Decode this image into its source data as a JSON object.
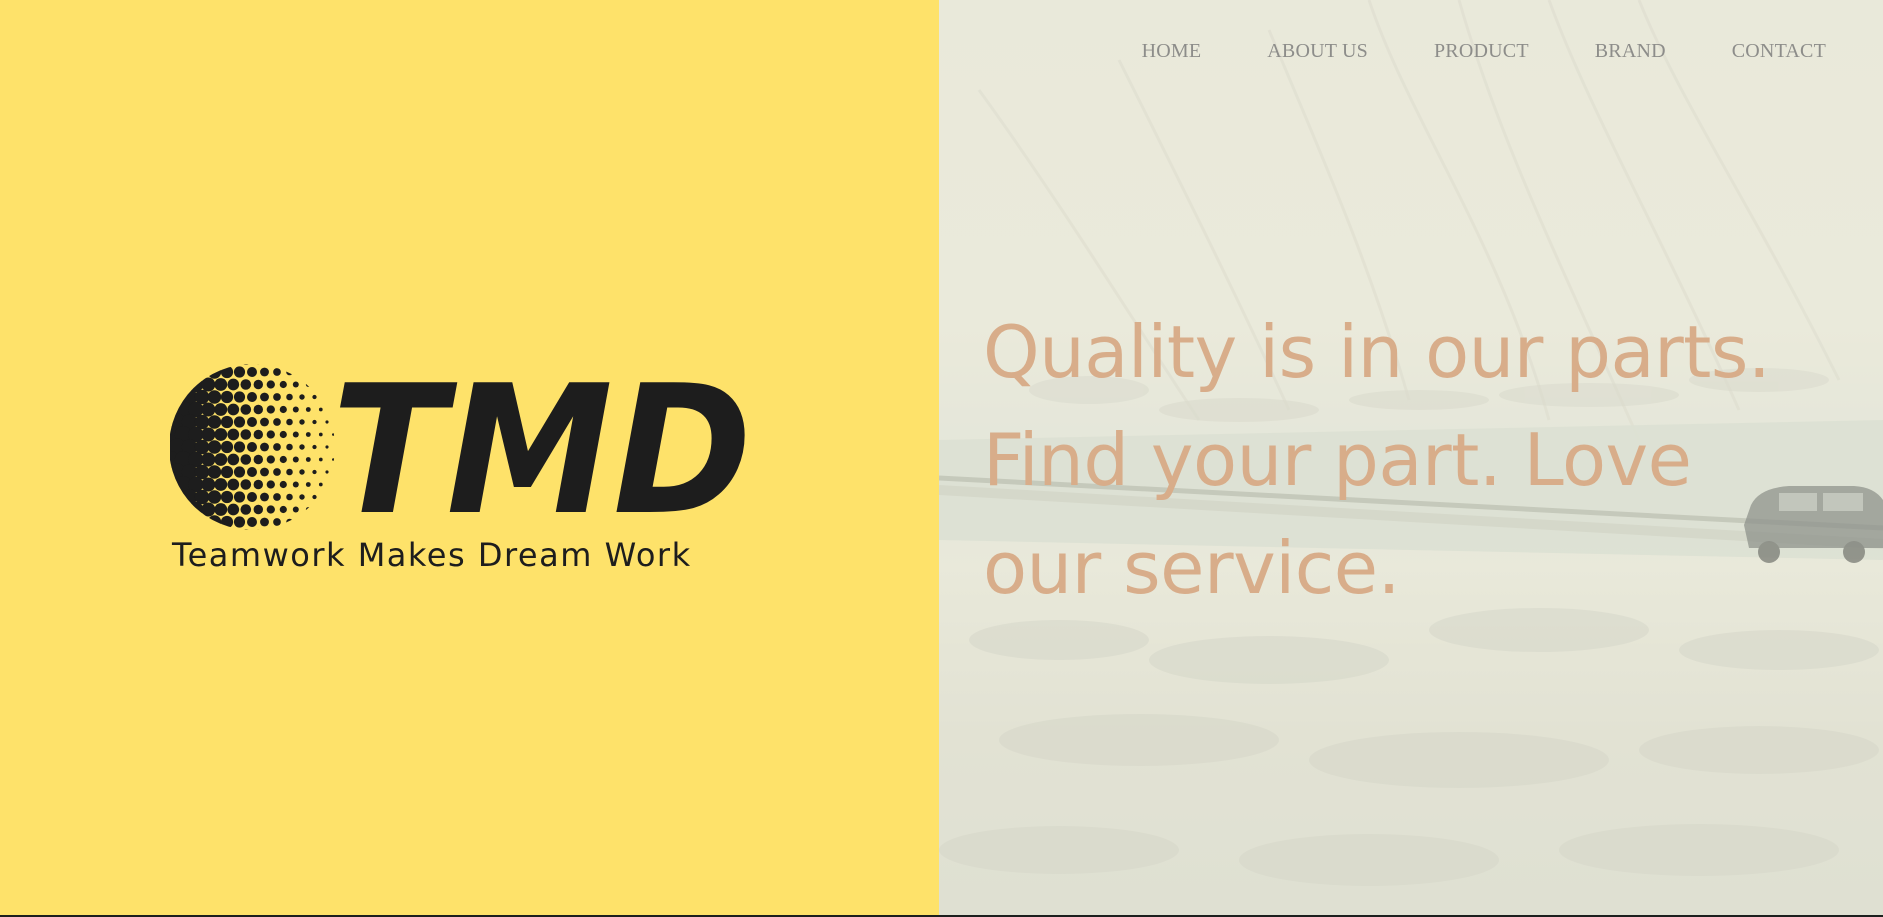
{
  "brand": {
    "logo_text": "TMD",
    "tagline": "Teamwork Makes Dream Work",
    "background_color": "#fee26a",
    "logo_color": "#1d1d1d"
  },
  "nav": {
    "items": [
      {
        "label": "HOME"
      },
      {
        "label": "ABOUT US"
      },
      {
        "label": "PRODUCT"
      },
      {
        "label": "BRAND"
      },
      {
        "label": "CONTACT"
      }
    ],
    "color": "#8d8d8a"
  },
  "hero": {
    "headline": "Quality is in our parts. Find your part. Love our service.",
    "headline_color": "#d8ad8a",
    "background": "snowy-mountain-road-with-car-photo"
  }
}
